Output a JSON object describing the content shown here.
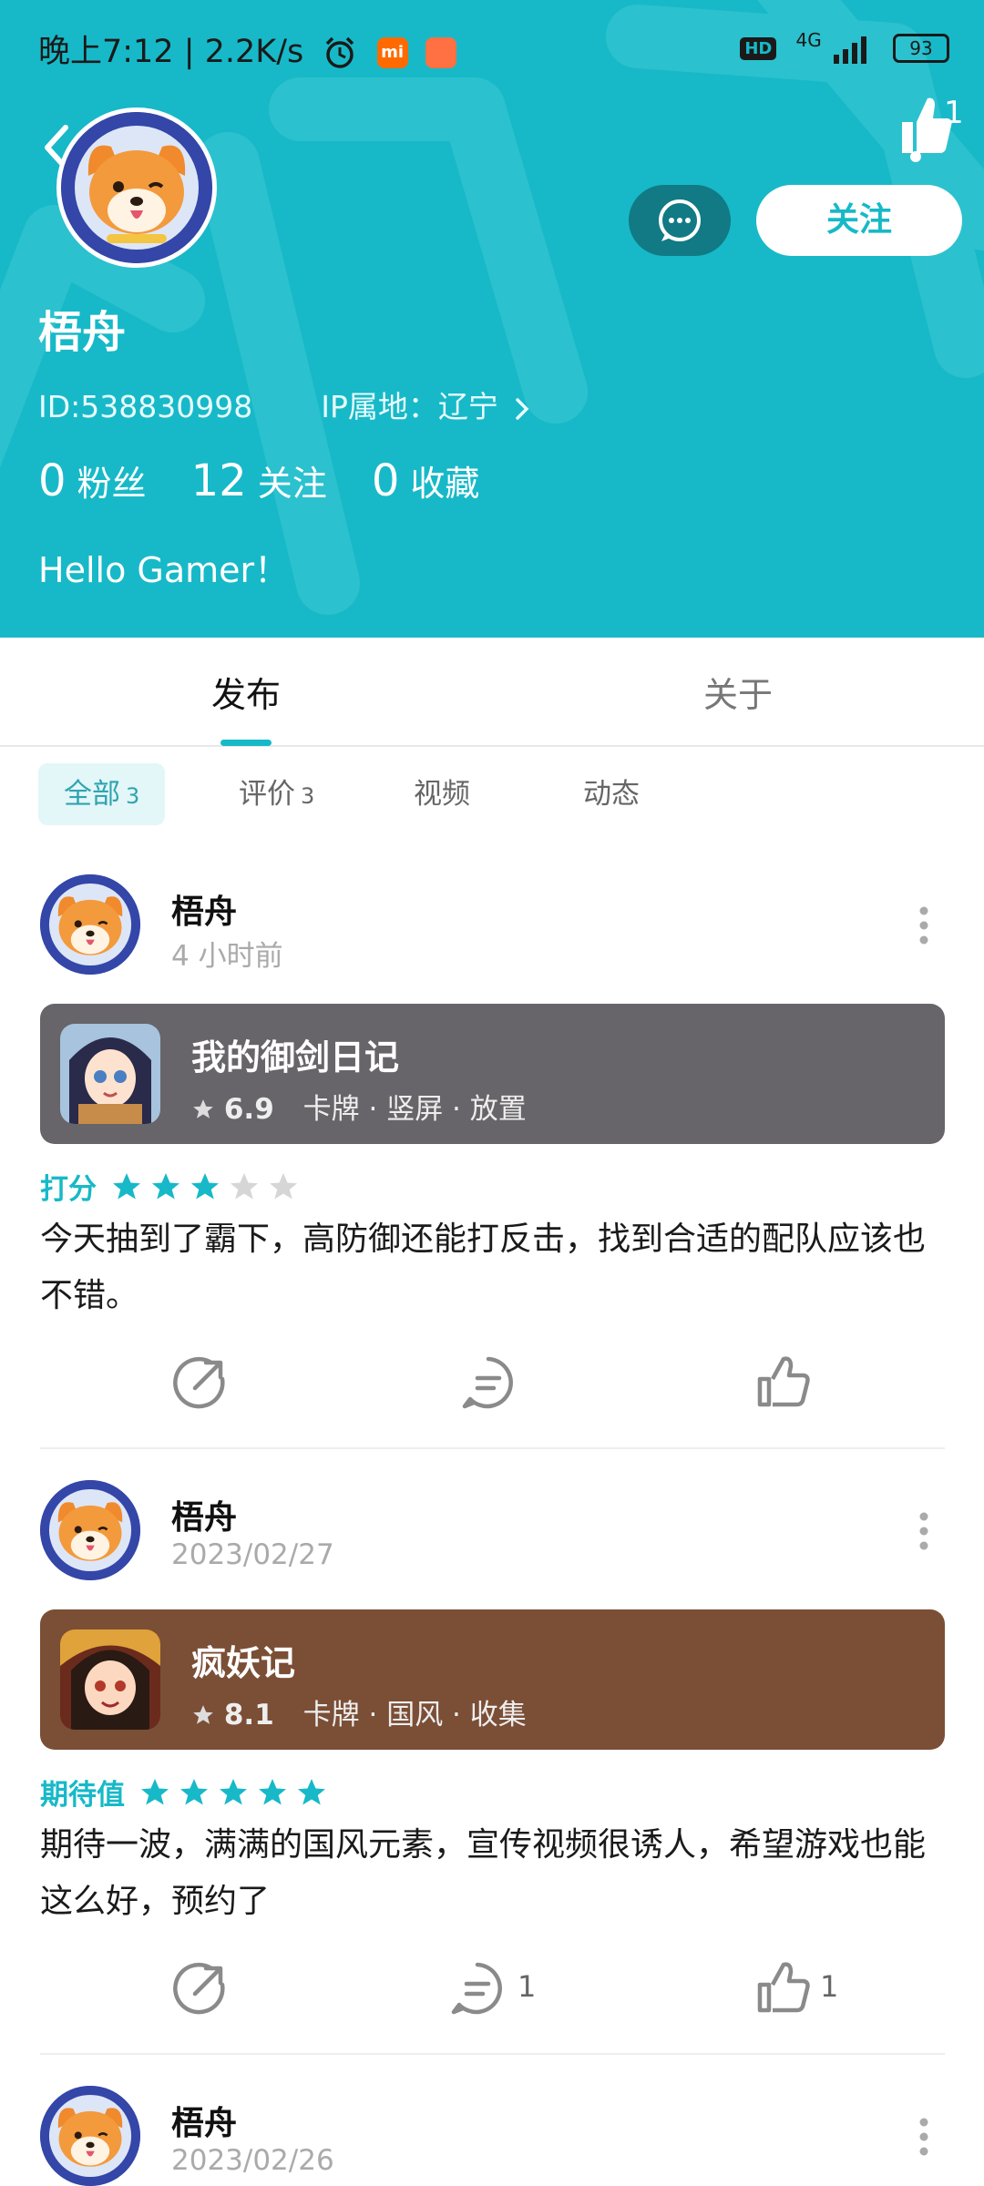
{
  "status_bar": {
    "time_speed": "晚上7:12 | 2.2K/s",
    "mi_label": "mi",
    "network": "4G",
    "hd": "HD",
    "battery": "93"
  },
  "profile": {
    "name": "梧舟",
    "id_text": "ID:538830998",
    "ip_text": "IP属地：辽宁",
    "bio": "Hello Gamer！",
    "likes": "1",
    "follow_label": "关注",
    "stats": [
      {
        "num": "0",
        "label": "粉丝"
      },
      {
        "num": "12",
        "label": "关注"
      },
      {
        "num": "0",
        "label": "收藏"
      }
    ]
  },
  "tabs": [
    {
      "label": "发布",
      "active": true
    },
    {
      "label": "关于",
      "active": false
    }
  ],
  "filters": [
    {
      "label": "全部",
      "count": "3",
      "active": true
    },
    {
      "label": "评价",
      "count": "3",
      "active": false
    },
    {
      "label": "视频",
      "count": "",
      "active": false
    },
    {
      "label": "动态",
      "count": "",
      "active": false
    }
  ],
  "posts": [
    {
      "author": "梧舟",
      "time": "4 小时前",
      "game": {
        "title": "我的御剑日记",
        "score": "6.9",
        "tags": "卡牌 · 竖屏 · 放置",
        "card_color": "#67656a"
      },
      "rating_label": "打分",
      "stars": 3,
      "text": "今天抽到了霸下，高防御还能打反击，找到合适的配队应该也不错。",
      "comments": "",
      "likes": ""
    },
    {
      "author": "梧舟",
      "time": "2023/02/27",
      "game": {
        "title": "疯妖记",
        "score": "8.1",
        "tags": "卡牌 · 国风 · 收集",
        "card_color": "#7b4e36"
      },
      "rating_label": "期待值",
      "stars": 5,
      "text": "期待一波，满满的国风元素，宣传视频很诱人，希望游戏也能这么好，预约了",
      "comments": "1",
      "likes": "1"
    },
    {
      "author": "梧舟",
      "time": "2023/02/26"
    }
  ],
  "colors": {
    "accent": "#17b9c8",
    "header_bg": "#17b9c8",
    "star_off": "#d6d6d6"
  }
}
